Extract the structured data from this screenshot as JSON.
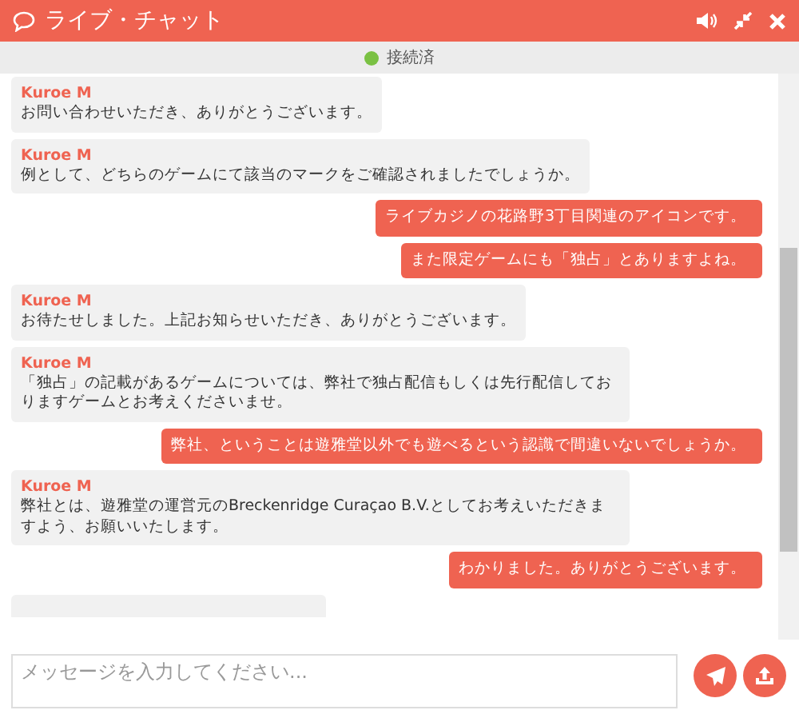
{
  "window": {
    "title": "ライブ・チャット"
  },
  "status": {
    "text": "接続済",
    "connected": true
  },
  "messages": [
    {
      "kind": "agent",
      "sender": "Kuroe M",
      "text": "お問い合わせいただき、ありがとうございます。"
    },
    {
      "kind": "agent",
      "sender": "Kuroe M",
      "text": "例として、どちらのゲームにて該当のマークをご確認されましたでしょうか。"
    },
    {
      "kind": "user",
      "text": "ライブカジノの花路野3丁目関連のアイコンです。"
    },
    {
      "kind": "user",
      "text": "また限定ゲームにも「独占」とありますよね。"
    },
    {
      "kind": "agent",
      "sender": "Kuroe M",
      "text": "お待たせしました。上記お知らせいただき、ありがとうございます。"
    },
    {
      "kind": "agent",
      "sender": "Kuroe M",
      "text": "「独占」の記載があるゲームについては、弊社で独占配信もしくは先行配信しておりますゲームとお考えくださいませ。"
    },
    {
      "kind": "user",
      "text": "弊社、ということは遊雅堂以外でも遊べるという認識で間違いないでしょうか。"
    },
    {
      "kind": "agent",
      "sender": "Kuroe M",
      "text": "弊社とは、遊雅堂の運営元のBreckenridge Curaçao B.V.としてお考えいただきますよう、お願いいたします。"
    },
    {
      "kind": "user",
      "text": "わかりました。ありがとうございます。"
    },
    {
      "kind": "stub"
    }
  ],
  "composer": {
    "placeholder": "メッセージを入力してください..."
  }
}
